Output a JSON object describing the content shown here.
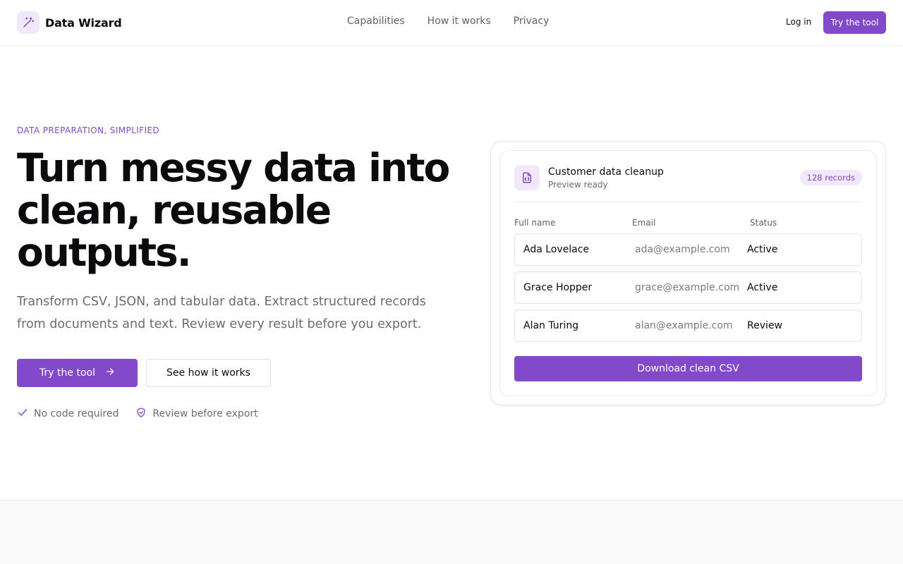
{
  "brand": {
    "name": "Data Wizard",
    "icon": "magic-wand-icon"
  },
  "nav": {
    "items": [
      {
        "label": "Capabilities"
      },
      {
        "label": "How it works"
      },
      {
        "label": "Privacy"
      }
    ]
  },
  "header_actions": {
    "login_label": "Log in",
    "try_label": "Try the tool"
  },
  "hero": {
    "eyebrow": "DATA PREPARATION, SIMPLIFIED",
    "title": "Turn messy data into clean, reusable outputs.",
    "subtitle": "Transform CSV, JSON, and tabular data. Extract structured records from documents and text. Review every result before you export.",
    "primary_cta": "Try the tool",
    "secondary_cta": "See how it works",
    "trust": [
      {
        "label": "No code required",
        "icon": "check-icon"
      },
      {
        "label": "Review before export",
        "icon": "shield-check-icon"
      }
    ]
  },
  "preview": {
    "title": "Customer data cleanup",
    "subtitle": "Preview ready",
    "badge": "128 records",
    "columns": [
      "Full name",
      "Email",
      "Status"
    ],
    "rows": [
      {
        "name": "Ada Lovelace",
        "email": "ada@example.com",
        "status": "Active"
      },
      {
        "name": "Grace Hopper",
        "email": "grace@example.com",
        "status": "Active"
      },
      {
        "name": "Alan Turing",
        "email": "alan@example.com",
        "status": "Review"
      }
    ],
    "download_label": "Download clean CSV"
  },
  "colors": {
    "accent": "#8349cb",
    "accent_soft": "#f1e8fb",
    "text": "#0b0b0d",
    "muted": "#6c6c74"
  }
}
